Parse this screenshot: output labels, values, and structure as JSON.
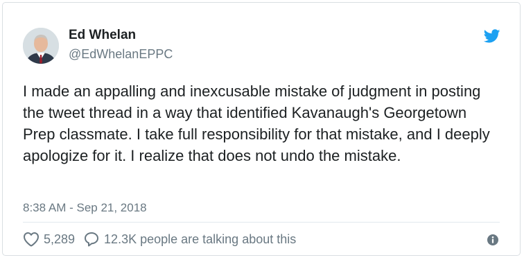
{
  "tweet": {
    "author_name": "Ed Whelan",
    "author_handle": "@EdWhelanEPPC",
    "text": "I made an appalling and inexcusable mistake of judgment in posting the tweet thread in a way that identified Kavanaugh's Georgetown Prep classmate. I take full responsibility for that mistake, and I deeply apologize for it. I realize that does not undo the mistake.",
    "timestamp": "8:38 AM - Sep 21, 2018",
    "likes": "5,289",
    "talking": "12.3K people are talking about this"
  },
  "icons": {
    "platform": "twitter-bird-icon",
    "like": "heart-icon",
    "reply": "speech-bubble-icon",
    "info": "info-icon"
  },
  "colors": {
    "brand": "#1da1f2",
    "text": "#1c2022",
    "muted": "#697882",
    "border": "#d9dee2"
  }
}
